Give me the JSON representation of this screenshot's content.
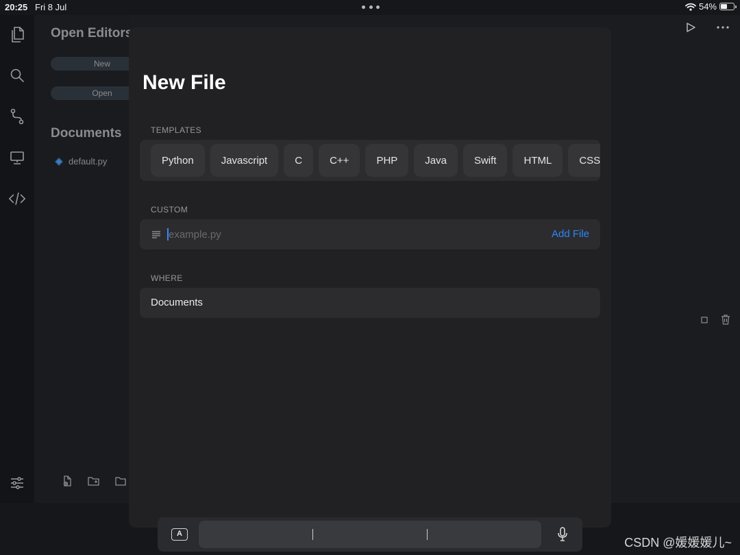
{
  "status_bar": {
    "time": "20:25",
    "date": "Fri 8 Jul",
    "battery": "54%",
    "battery_level": 0.54
  },
  "sidebar": {
    "open_editors_title": "Open Editors",
    "new_button": "New",
    "open_button": "Open",
    "documents_title": "Documents",
    "file_name": "default.py"
  },
  "modal": {
    "title": "New File",
    "templates_label": "TEMPLATES",
    "templates": [
      "Python",
      "Javascript",
      "C",
      "C++",
      "PHP",
      "Java",
      "Swift",
      "HTML",
      "CSS"
    ],
    "custom_label": "CUSTOM",
    "filename_placeholder": "example.py",
    "add_file_label": "Add File",
    "where_label": "WHERE",
    "where_value": "Documents"
  },
  "dictation": {
    "keyboard_label": "A"
  },
  "watermark": "CSDN @媛媛媛儿~",
  "colors": {
    "accent": "#2f86f6",
    "modal_bg": "#212124",
    "card_bg": "#2c2c2f"
  }
}
